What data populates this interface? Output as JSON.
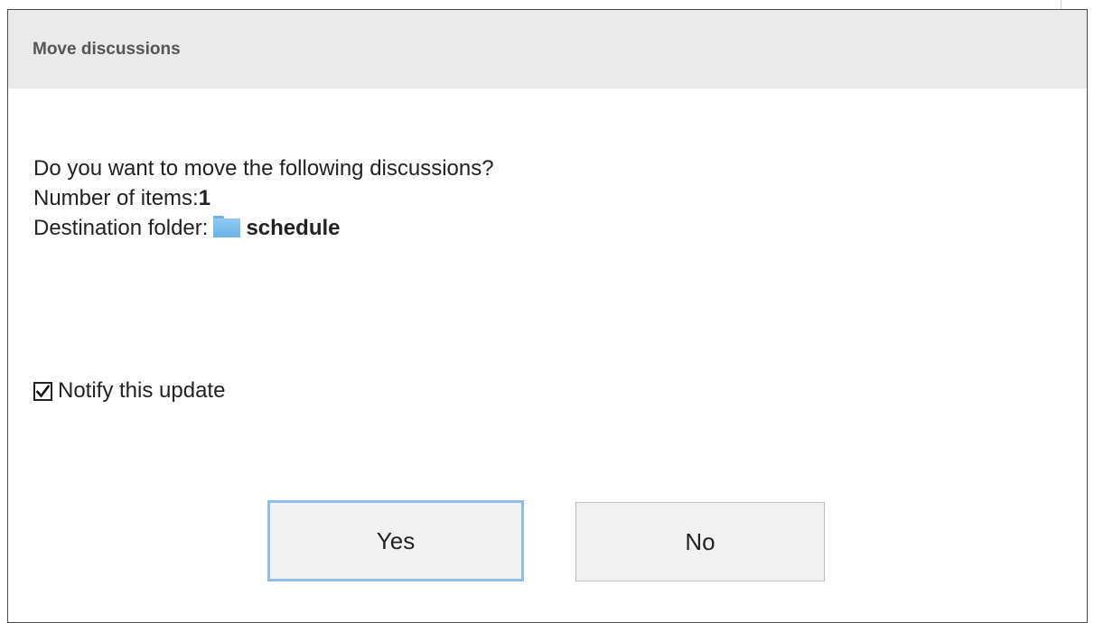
{
  "dialog": {
    "title": "Move discussions",
    "question": "Do you want to move the following discussions?",
    "items_label": "Number of items:",
    "items_count": "1",
    "destination_label": "Destination folder:",
    "destination_folder": "schedule",
    "folder_icon": "folder-icon",
    "notify": {
      "label": "Notify this update",
      "checked": true
    },
    "buttons": {
      "yes": "Yes",
      "no": "No"
    }
  },
  "colors": {
    "header_bg": "#eaeaea",
    "focus_border": "#8ebde6",
    "folder": "#6ab3e6"
  }
}
